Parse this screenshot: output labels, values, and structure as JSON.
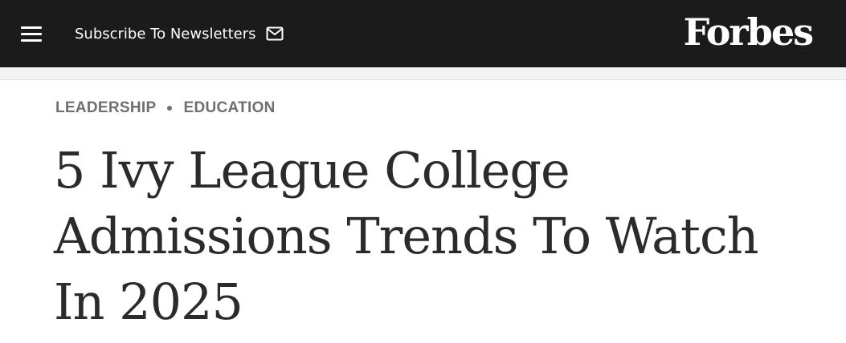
{
  "header": {
    "subscribe_label": "Subscribe To Newsletters",
    "logo_text": "Forbes",
    "menu_icon": "hamburger-menu-icon",
    "mail_icon": "envelope-icon",
    "background_color": "#1b1b1b"
  },
  "article": {
    "channels": [
      "LEADERSHIP",
      "EDUCATION"
    ],
    "headline": "5 Ivy League College Admissions Trends To Watch In 2025"
  }
}
